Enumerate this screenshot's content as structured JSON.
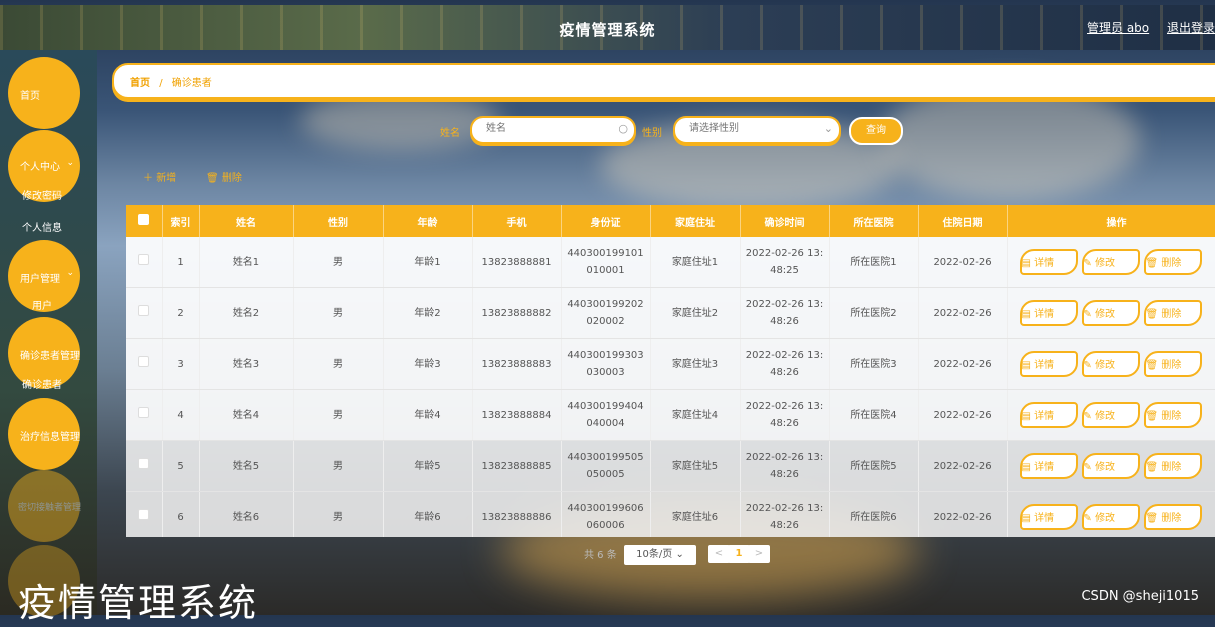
{
  "header": {
    "title": "疫情管理系统",
    "user": "管理员 abo",
    "logout": "退出登录"
  },
  "sidebar": {
    "home": "首页",
    "personal_center": "个人中心",
    "change_password": "修改密码",
    "personal_info": "个人信息",
    "user_management": "用户管理",
    "users": "用户",
    "confirmed_management": "确诊患者管理",
    "confirmed_patients": "确诊患者",
    "treatment_management": "治疗信息管理",
    "close_contact_management": "密切接触者管理"
  },
  "breadcrumb": {
    "home": "首页",
    "separator": "/",
    "current": "确诊患者"
  },
  "search": {
    "name_label": "姓名",
    "name_placeholder": "姓名",
    "gender_label": "性别",
    "gender_placeholder": "请选择性别",
    "query_label": "查询"
  },
  "actions": {
    "add": "新增",
    "delete": "删除"
  },
  "table": {
    "columns": [
      "索引",
      "姓名",
      "性别",
      "年龄",
      "手机",
      "身份证",
      "家庭住址",
      "确诊时间",
      "所在医院",
      "住院日期",
      "操作"
    ],
    "rows": [
      {
        "index": "1",
        "name": "姓名1",
        "gender": "男",
        "age": "年龄1",
        "phone": "13823888881",
        "id1": "440300199101",
        "id2": "010001",
        "address": "家庭住址1",
        "time1": "2022-02-26 13:",
        "time2": "48:25",
        "hospital": "所在医院1",
        "date": "2022-02-26"
      },
      {
        "index": "2",
        "name": "姓名2",
        "gender": "男",
        "age": "年龄2",
        "phone": "13823888882",
        "id1": "440300199202",
        "id2": "020002",
        "address": "家庭住址2",
        "time1": "2022-02-26 13:",
        "time2": "48:26",
        "hospital": "所在医院2",
        "date": "2022-02-26"
      },
      {
        "index": "3",
        "name": "姓名3",
        "gender": "男",
        "age": "年龄3",
        "phone": "13823888883",
        "id1": "440300199303",
        "id2": "030003",
        "address": "家庭住址3",
        "time1": "2022-02-26 13:",
        "time2": "48:26",
        "hospital": "所在医院3",
        "date": "2022-02-26"
      },
      {
        "index": "4",
        "name": "姓名4",
        "gender": "男",
        "age": "年龄4",
        "phone": "13823888884",
        "id1": "440300199404",
        "id2": "040004",
        "address": "家庭住址4",
        "time1": "2022-02-26 13:",
        "time2": "48:26",
        "hospital": "所在医院4",
        "date": "2022-02-26"
      },
      {
        "index": "5",
        "name": "姓名5",
        "gender": "男",
        "age": "年龄5",
        "phone": "13823888885",
        "id1": "440300199505",
        "id2": "050005",
        "address": "家庭住址5",
        "time1": "2022-02-26 13:",
        "time2": "48:26",
        "hospital": "所在医院5",
        "date": "2022-02-26"
      },
      {
        "index": "6",
        "name": "姓名6",
        "gender": "男",
        "age": "年龄6",
        "phone": "13823888886",
        "id1": "440300199606",
        "id2": "060006",
        "address": "家庭住址6",
        "time1": "2022-02-26 13:",
        "time2": "48:26",
        "hospital": "所在医院6",
        "date": "2022-02-26"
      }
    ],
    "op_detail": "详情",
    "op_edit": "修改",
    "op_delete": "删除"
  },
  "pagination": {
    "total": "共 6 条",
    "page_size": "10条/页",
    "prev": "<",
    "page": "1",
    "next": ">"
  },
  "overlay_title": "疫情管理系统",
  "watermark": "CSDN @sheji1015",
  "colors": {
    "accent": "#f7b21b"
  }
}
